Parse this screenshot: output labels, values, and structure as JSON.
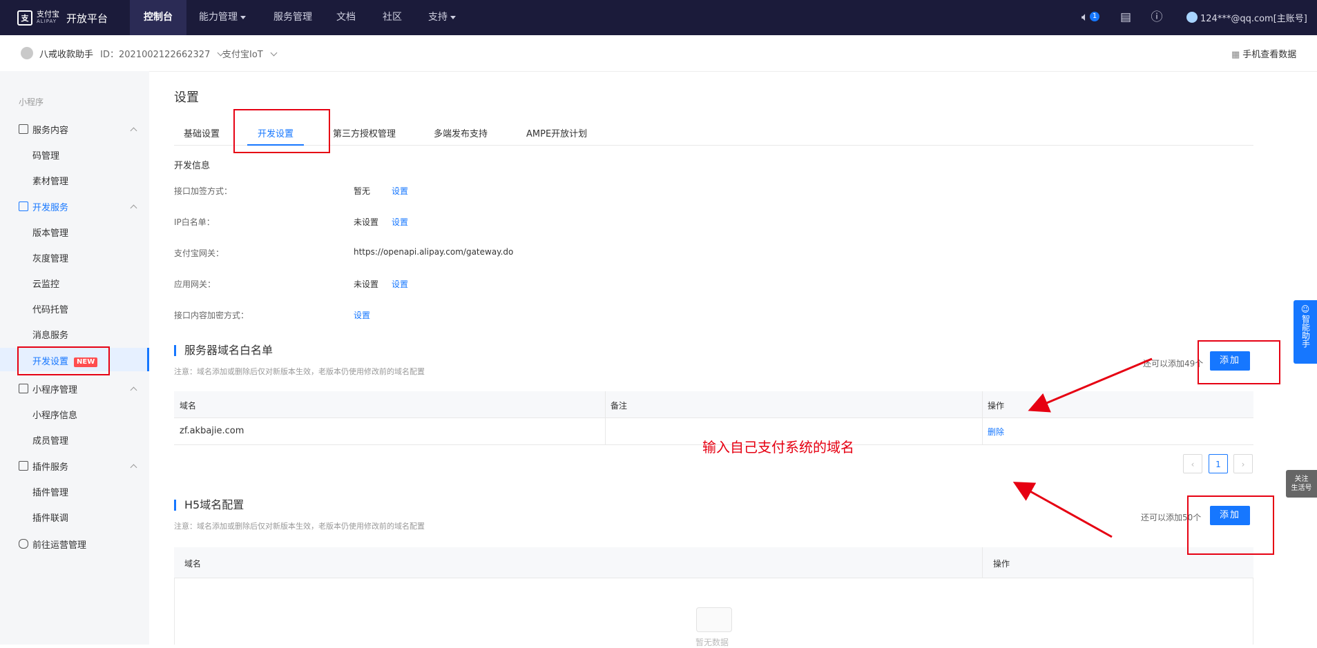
{
  "topbar": {
    "logo_cn": "支付宝",
    "logo_en": "ALIPAY",
    "title": "开放平台",
    "nav": [
      "控制台",
      "能力管理",
      "服务管理",
      "文档",
      "社区",
      "支持"
    ],
    "notice_count": "1",
    "account": "124***@qq.com[主账号]"
  },
  "subbar": {
    "app_name": "八戒收款助手",
    "app_id": "ID：2021002122662327",
    "product": "支付宝IoT",
    "mobile_data": "手机查看数据"
  },
  "sidebar": {
    "heading": "小程序",
    "groups": [
      {
        "label": "服务内容",
        "items": [
          "码管理",
          "素材管理"
        ]
      },
      {
        "label": "开发服务",
        "items": [
          "版本管理",
          "灰度管理",
          "云监控",
          "代码托管",
          "消息服务",
          "开发设置"
        ]
      },
      {
        "label": "小程序管理",
        "items": [
          "小程序信息",
          "成员管理"
        ]
      },
      {
        "label": "插件服务",
        "items": [
          "插件管理",
          "插件联调"
        ]
      },
      {
        "label": "前往运营管理",
        "items": []
      }
    ],
    "new_tag": "NEW"
  },
  "main": {
    "title": "设置",
    "tabs": [
      "基础设置",
      "开发设置",
      "第三方授权管理",
      "多端发布支持",
      "AMPE开放计划"
    ],
    "dev_info_title": "开发信息",
    "dev_rows": [
      {
        "label": "接口加签方式：",
        "value": "暂无",
        "action": "设置"
      },
      {
        "label": "IP白名单：",
        "value": "未设置",
        "action": "设置"
      },
      {
        "label": "支付宝网关：",
        "value": "https://openapi.alipay.com/gateway.do",
        "action": ""
      },
      {
        "label": "应用网关：",
        "value": "未设置",
        "action": "设置"
      },
      {
        "label": "接口内容加密方式：",
        "value": "",
        "action": "设置"
      }
    ],
    "server_whitelist": {
      "title": "服务器域名白名单",
      "note": "注意：域名添加或删除后仅对新版本生效，老版本仍使用修改前的域名配置",
      "remaining": "还可以添加49个",
      "add_label": "添加",
      "columns": [
        "域名",
        "备注",
        "操作"
      ],
      "rows": [
        {
          "domain": "zf.akbajie.com",
          "remark": "",
          "action": "删除"
        }
      ],
      "page": "1"
    },
    "h5_config": {
      "title": "H5域名配置",
      "note": "注意：域名添加或删除后仅对新版本生效，老版本仍使用修改前的域名配置",
      "remaining": "还可以添加50个",
      "add_label": "添加",
      "columns": [
        "域名",
        "操作"
      ],
      "empty": "暂无数据"
    }
  },
  "annotation": "输入自己支付系统的域名",
  "floating": {
    "assistant": "智能助手",
    "follow_1": "关注",
    "follow_2": "生活号"
  },
  "colors": {
    "accent": "#1677ff",
    "topbar": "#1b1b3a",
    "annotation": "#e60012"
  }
}
